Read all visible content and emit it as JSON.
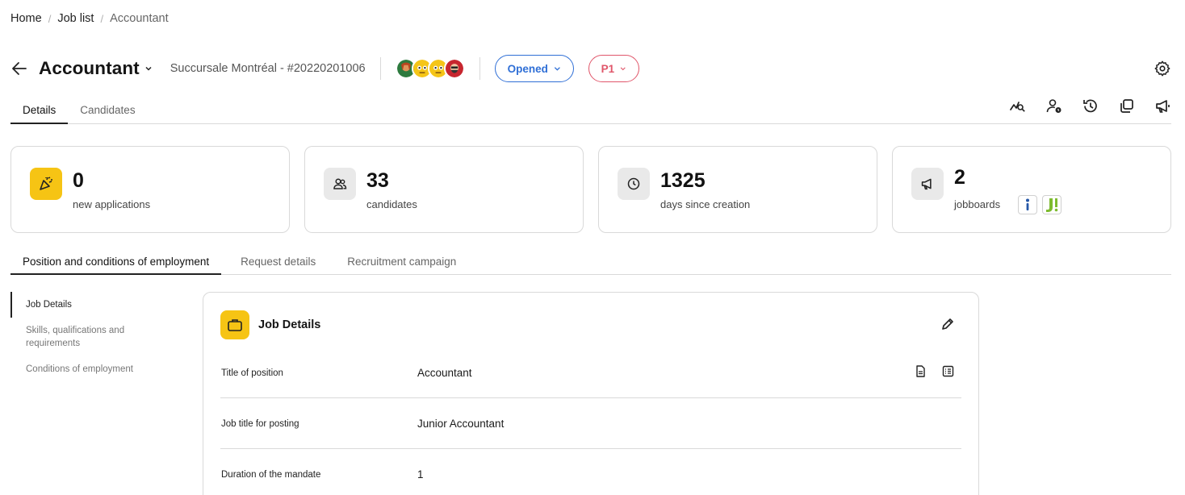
{
  "breadcrumb": [
    "Home",
    "Job list",
    "Accountant"
  ],
  "header": {
    "title": "Accountant",
    "subtitle": "Succursale Montréal - #20220201006",
    "status": "Opened",
    "priority": "P1"
  },
  "tabs_top": [
    "Details",
    "Candidates"
  ],
  "stats": {
    "new_applications": {
      "value": "0",
      "label": "new applications"
    },
    "candidates": {
      "value": "33",
      "label": "candidates"
    },
    "days": {
      "value": "1325",
      "label": "days since creation"
    },
    "jobboards": {
      "value": "2",
      "label": "jobboards"
    }
  },
  "tabs_sec": [
    "Position and conditions of employment",
    "Request details",
    "Recruitment campaign"
  ],
  "sidenav": [
    "Job Details",
    "Skills, qualifications and requirements",
    "Conditions of employment"
  ],
  "panel": {
    "title": "Job Details",
    "rows": [
      {
        "key": "Title of position",
        "value": "Accountant"
      },
      {
        "key": "Job title for posting",
        "value": "Junior Accountant"
      },
      {
        "key": "Duration of the mandate",
        "value": "1"
      }
    ]
  },
  "colors": {
    "accent_blue": "#2f6fd6",
    "priority_red": "#e0566a",
    "yellow": "#f6c414"
  },
  "icons": [
    "back-arrow-icon",
    "chevron-down-icon",
    "gear-icon",
    "analytics-icon",
    "assign-user-icon",
    "history-icon",
    "duplicate-icon",
    "megaphone-icon",
    "party-popper-icon",
    "users-icon",
    "clock-icon",
    "briefcase-icon",
    "pencil-icon",
    "document-icon",
    "list-icon"
  ]
}
